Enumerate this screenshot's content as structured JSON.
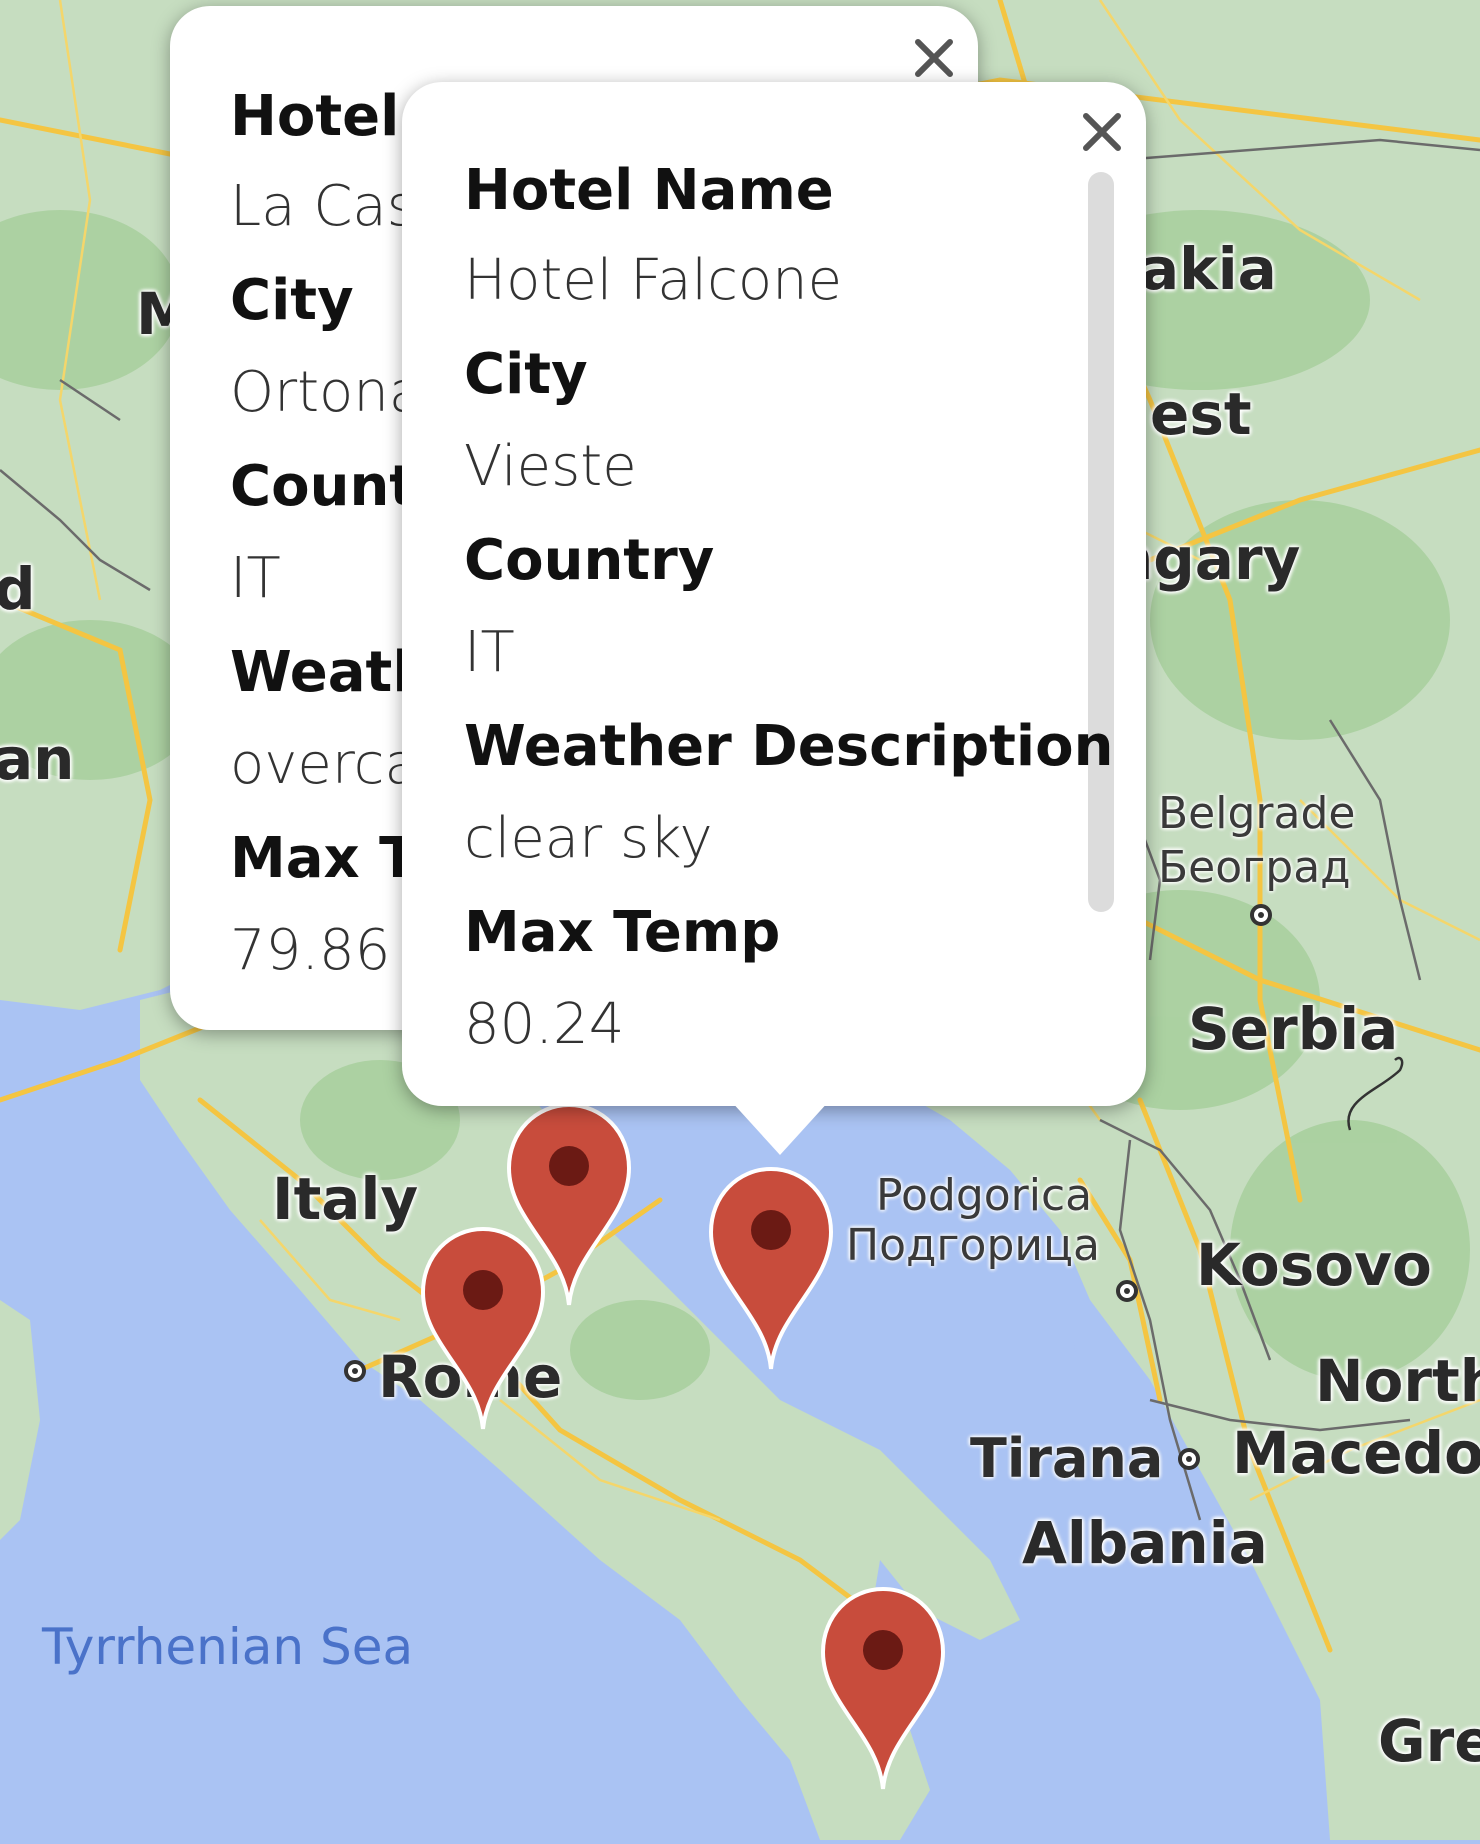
{
  "map": {
    "colors": {
      "water": "#aac3f3",
      "land": "#c6ddc0",
      "forest": "#a7cf9c",
      "road": "#f4c542",
      "border": "#555555"
    },
    "country_labels": [
      "akia",
      "est",
      "ngary",
      "Serbia",
      "Italy",
      "Kosovo",
      "North",
      "Macedo",
      "Albania",
      "Gre",
      "d",
      "an",
      "M"
    ],
    "city_labels": [
      "Rome",
      "Belgrade",
      "Београд",
      "Podgorica",
      "Подгорица",
      "Tirana"
    ],
    "sea_label": "Tyrrhenian Sea"
  },
  "popup_back": {
    "labels": [
      "Hotel Name",
      "City",
      "Country",
      "Weather Description",
      "Max Temp"
    ],
    "values": [
      "La Casa",
      "Ortona",
      "IT",
      "overcast clouds",
      "79.86"
    ],
    "visible_labels": [
      "Hotel I",
      "City",
      "Count",
      "Weath",
      "Max T"
    ],
    "visible_values": [
      "La Cas",
      "Ortona",
      "IT",
      "overca",
      "79.86"
    ],
    "close_icon": "close-icon"
  },
  "popup_front": {
    "hotel_name_label": "Hotel Name",
    "hotel_name": "Hotel Falcone",
    "city_label": "City",
    "city": "Vieste",
    "country_label": "Country",
    "country": "IT",
    "weather_label": "Weather Description",
    "weather": "clear sky",
    "max_temp_label": "Max Temp",
    "max_temp": "80.24",
    "close_icon": "close-icon"
  },
  "markers": [
    {
      "name": "marker-ortona"
    },
    {
      "name": "marker-rome-area"
    },
    {
      "name": "marker-vieste"
    },
    {
      "name": "marker-south"
    }
  ],
  "marker_color": "#c84c3c"
}
